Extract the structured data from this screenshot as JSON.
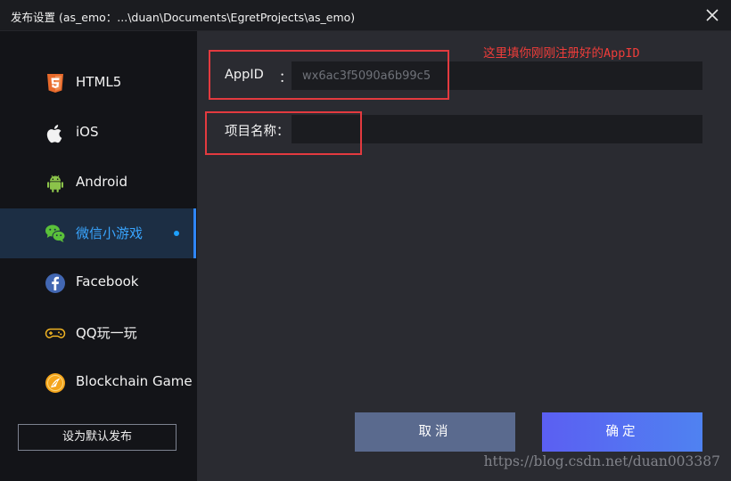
{
  "window": {
    "title": "发布设置 (as_emo：...\\duan\\Documents\\EgretProjects\\as_emo)"
  },
  "sidebar": {
    "items": [
      {
        "label": "HTML5",
        "icon": "html5-icon",
        "active": false
      },
      {
        "label": "iOS",
        "icon": "apple-icon",
        "active": false
      },
      {
        "label": "Android",
        "icon": "android-icon",
        "active": false
      },
      {
        "label": "微信小游戏",
        "icon": "wechat-icon",
        "active": true
      },
      {
        "label": "Facebook",
        "icon": "facebook-icon",
        "active": false
      },
      {
        "label": "QQ玩一玩",
        "icon": "gamepad-icon",
        "active": false
      },
      {
        "label": "Blockchain Game",
        "icon": "blockchain-icon",
        "active": false
      }
    ],
    "default_button": "设为默认发布"
  },
  "form": {
    "appid_label": "AppID",
    "appid_colon": "：",
    "appid_placeholder": "wx6ac3f5090a6b99c5",
    "appid_value": "",
    "project_label": "项目名称：",
    "project_value": ""
  },
  "annotation": {
    "text": "这里填你刚刚注册好的AppID",
    "color": "#e33a3f"
  },
  "buttons": {
    "cancel": "取消",
    "ok": "确定"
  },
  "watermark": "https://blog.csdn.net/duan003387",
  "colors": {
    "accent": "#2f86f6",
    "active_bg": "#1c2e44",
    "annotation": "#e33a3f"
  }
}
